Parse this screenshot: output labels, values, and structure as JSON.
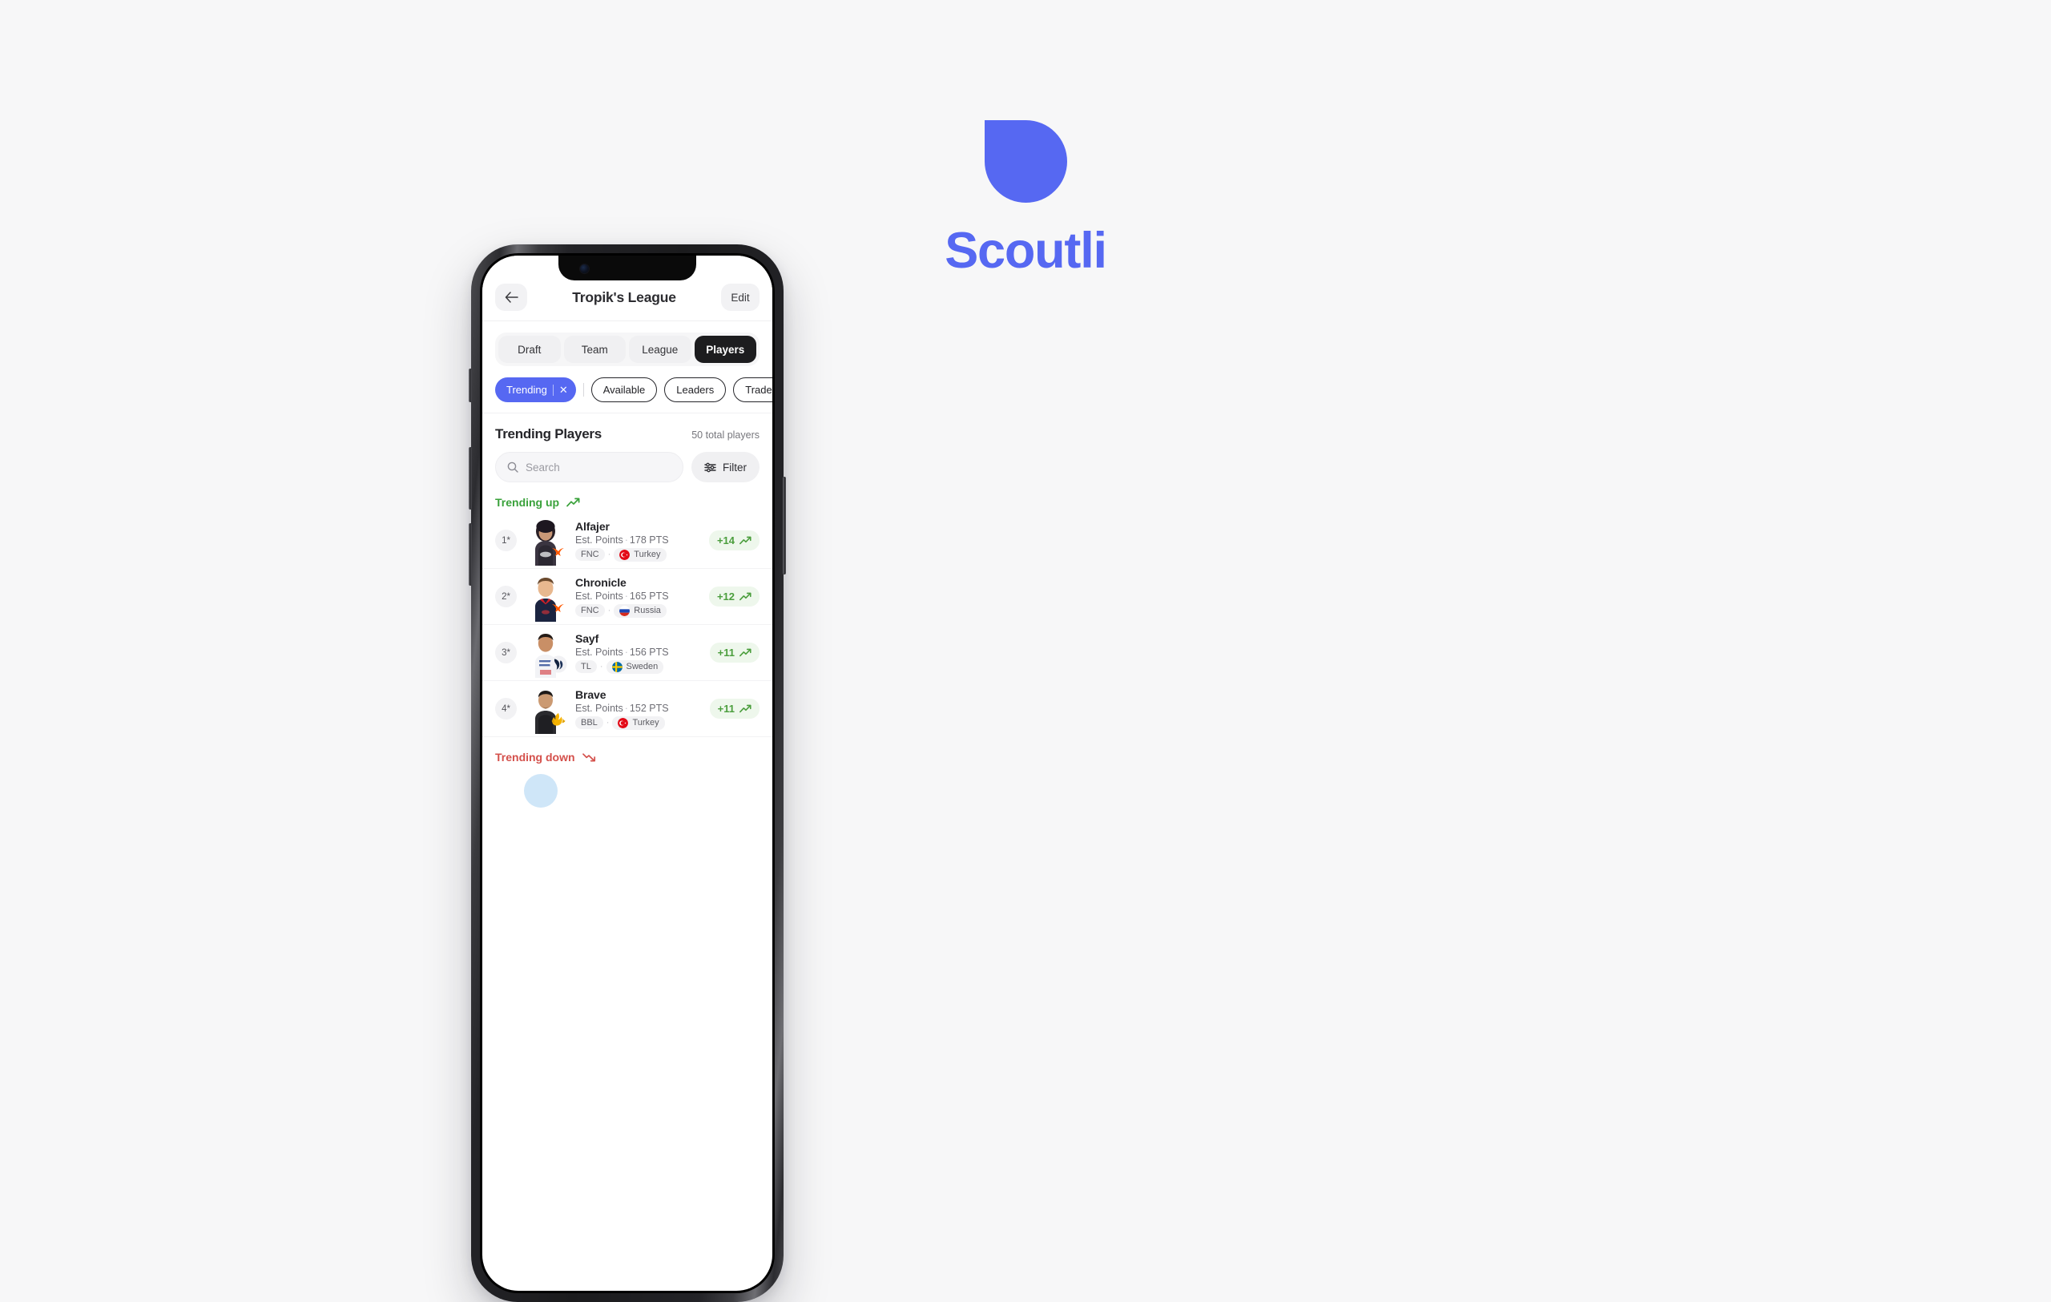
{
  "brand": {
    "name": "Scoutli",
    "color": "#5668f2",
    "logo_icon": "droplet-logo-icon"
  },
  "header": {
    "title": "Tropik's League",
    "back_icon": "arrow-left-icon",
    "edit_label": "Edit"
  },
  "segmented": {
    "tabs": [
      {
        "label": "Draft",
        "active": false
      },
      {
        "label": "Team",
        "active": false
      },
      {
        "label": "League",
        "active": false
      },
      {
        "label": "Players",
        "active": true
      }
    ]
  },
  "chips": [
    {
      "label": "Trending",
      "active": true,
      "close_icon": "close-icon",
      "close_label": "✕"
    },
    {
      "label": "Available",
      "active": false
    },
    {
      "label": "Leaders",
      "active": false
    },
    {
      "label": "Trade",
      "active": false
    }
  ],
  "list": {
    "title": "Trending Players",
    "count_label": "50 total players"
  },
  "search": {
    "placeholder": "Search",
    "value": "",
    "icon": "search-icon",
    "filter_label": "Filter",
    "filter_icon": "sliders-icon"
  },
  "groups": [
    {
      "id": "trending-up",
      "label": "Trending up",
      "icon": "trending-up-icon",
      "color": "#39a13a",
      "players": [
        {
          "rank": "1*",
          "name": "Alfajer",
          "points_label": "Est. Points",
          "points_value": "178 PTS",
          "team": "FNC",
          "country": "Turkey",
          "flag": "turkey-flag-icon",
          "team_logo": "fnatic-logo-icon",
          "delta": "+14",
          "delta_icon": "trending-up-icon"
        },
        {
          "rank": "2*",
          "name": "Chronicle",
          "points_label": "Est. Points",
          "points_value": "165 PTS",
          "team": "FNC",
          "country": "Russia",
          "flag": "russia-flag-icon",
          "team_logo": "fnatic-logo-icon",
          "delta": "+12",
          "delta_icon": "trending-up-icon"
        },
        {
          "rank": "3*",
          "name": "Sayf",
          "points_label": "Est. Points",
          "points_value": "156 PTS",
          "team": "TL",
          "country": "Sweden",
          "flag": "sweden-flag-icon",
          "team_logo": "team-liquid-logo-icon",
          "delta": "+11",
          "delta_icon": "trending-up-icon"
        },
        {
          "rank": "4*",
          "name": "Brave",
          "points_label": "Est. Points",
          "points_value": "152 PTS",
          "team": "BBL",
          "country": "Turkey",
          "flag": "turkey-flag-icon",
          "team_logo": "bbl-logo-icon",
          "delta": "+11",
          "delta_icon": "trending-up-icon"
        }
      ]
    },
    {
      "id": "trending-down",
      "label": "Trending down",
      "icon": "trending-down-icon",
      "color": "#d4504b",
      "players": []
    }
  ],
  "colors": {
    "accent": "#5668f2",
    "active_tab": "#1d1d1f",
    "trending_up": "#39a13a",
    "trending_down": "#d4504b",
    "delta_badge_bg": "#eef7ec",
    "page_bg": "#f7f7f8"
  }
}
